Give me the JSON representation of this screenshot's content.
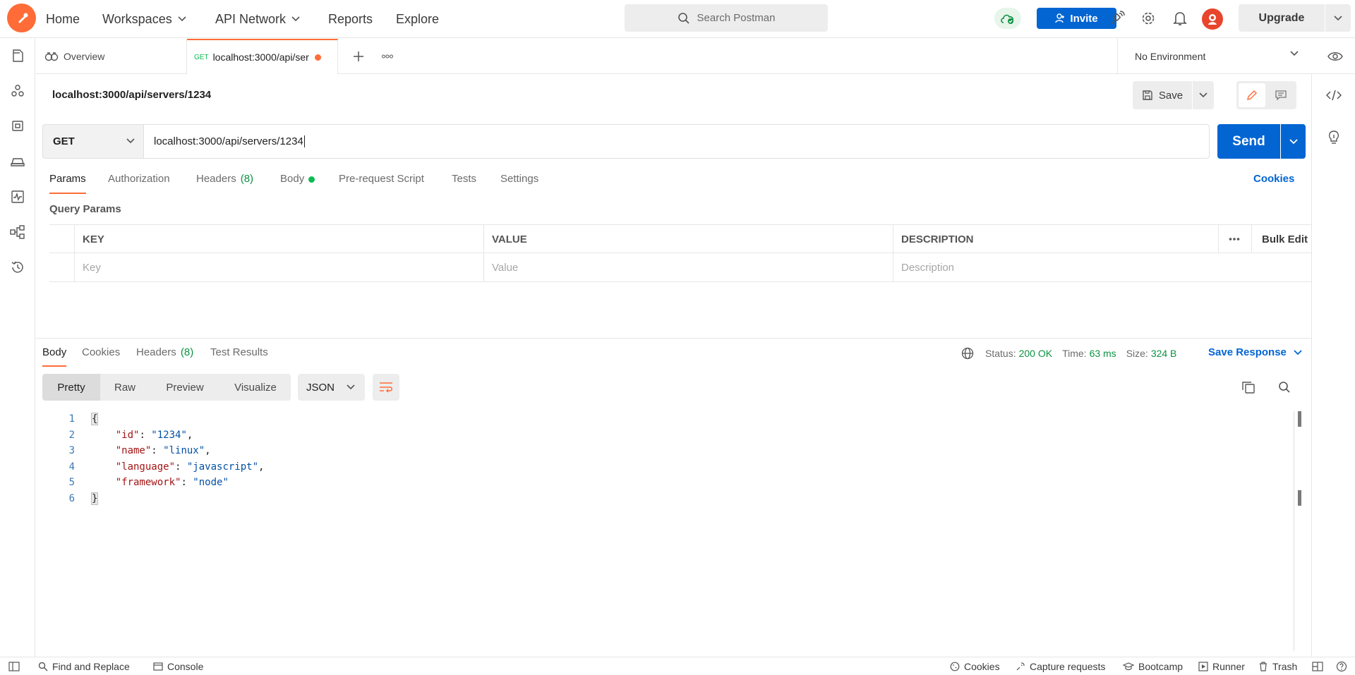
{
  "header": {
    "nav": [
      {
        "label": "Home"
      },
      {
        "label": "Workspaces"
      },
      {
        "label": "API Network"
      },
      {
        "label": "Reports"
      },
      {
        "label": "Explore"
      }
    ],
    "search_placeholder": "Search Postman",
    "invite_label": "Invite",
    "upgrade_label": "Upgrade"
  },
  "tabs": {
    "overview_label": "Overview",
    "active": {
      "method": "GET",
      "label": "localhost:3000/api/ser"
    },
    "environment": "No Environment"
  },
  "request": {
    "title": "localhost:3000/api/servers/1234",
    "save_label": "Save",
    "method": "GET",
    "url": "localhost:3000/api/servers/1234",
    "send_label": "Send",
    "tabs": {
      "params": "Params",
      "authorization": "Authorization",
      "headers": "Headers",
      "headers_count": "(8)",
      "body": "Body",
      "prerequest": "Pre-request Script",
      "tests": "Tests",
      "settings": "Settings"
    },
    "cookies_label": "Cookies",
    "query_params_title": "Query Params",
    "params_table": {
      "columns": {
        "key": "KEY",
        "value": "VALUE",
        "description": "DESCRIPTION"
      },
      "bulk_edit": "Bulk Edit",
      "placeholders": {
        "key": "Key",
        "value": "Value",
        "description": "Description"
      }
    }
  },
  "response": {
    "tabs": {
      "body": "Body",
      "cookies": "Cookies",
      "headers": "Headers",
      "headers_count": "(8)",
      "test_results": "Test Results"
    },
    "status_label": "Status:",
    "status_value": "200 OK",
    "time_label": "Time:",
    "time_value": "63 ms",
    "size_label": "Size:",
    "size_value": "324 B",
    "save_response_label": "Save Response",
    "formats": [
      "Pretty",
      "Raw",
      "Preview",
      "Visualize"
    ],
    "language": "JSON",
    "body_lines": [
      {
        "n": "1",
        "text": "{"
      },
      {
        "n": "2",
        "key": "\"id\"",
        "value": "\"1234\"",
        "sep": ","
      },
      {
        "n": "3",
        "key": "\"name\"",
        "value": "\"linux\"",
        "sep": ","
      },
      {
        "n": "4",
        "key": "\"language\"",
        "value": "\"javascript\"",
        "sep": ","
      },
      {
        "n": "5",
        "key": "\"framework\"",
        "value": "\"node\"",
        "sep": ""
      },
      {
        "n": "6",
        "text": "}"
      }
    ]
  },
  "footer": {
    "find_replace": "Find and Replace",
    "console": "Console",
    "cookies": "Cookies",
    "capture": "Capture requests",
    "bootcamp": "Bootcamp",
    "runner": "Runner",
    "trash": "Trash"
  },
  "colors": {
    "brand": "#ff6c37",
    "primary": "#0265d2",
    "success": "#0c9242"
  }
}
